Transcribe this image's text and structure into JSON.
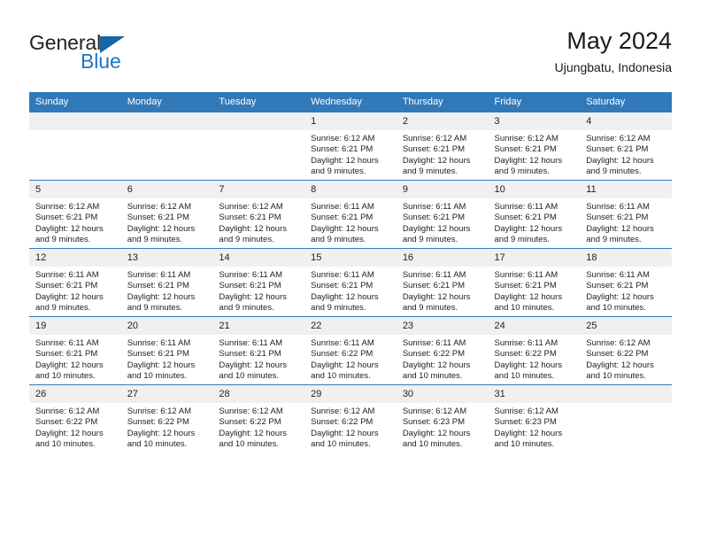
{
  "brand": {
    "name_part1": "General",
    "name_part2": "Blue",
    "triangle_color": "#1565a8",
    "blue_color": "#1b77c7"
  },
  "header": {
    "title": "May 2024",
    "subtitle": "Ujungbatu, Indonesia"
  },
  "theme": {
    "header_blue": "#3179b9",
    "daynum_band": "#f0f0f0",
    "text": "#222222"
  },
  "weekday_headers": [
    "Sunday",
    "Monday",
    "Tuesday",
    "Wednesday",
    "Thursday",
    "Friday",
    "Saturday"
  ],
  "labels": {
    "sunrise_prefix": "Sunrise:",
    "sunset_prefix": "Sunset:",
    "daylight_prefix": "Daylight:"
  },
  "weeks": [
    [
      {
        "day": "",
        "empty": true
      },
      {
        "day": "",
        "empty": true
      },
      {
        "day": "",
        "empty": true
      },
      {
        "day": "1",
        "sunrise": "Sunrise: 6:12 AM",
        "sunset": "Sunset: 6:21 PM",
        "daylight_line1": "Daylight: 12 hours",
        "daylight_line2": "and 9 minutes."
      },
      {
        "day": "2",
        "sunrise": "Sunrise: 6:12 AM",
        "sunset": "Sunset: 6:21 PM",
        "daylight_line1": "Daylight: 12 hours",
        "daylight_line2": "and 9 minutes."
      },
      {
        "day": "3",
        "sunrise": "Sunrise: 6:12 AM",
        "sunset": "Sunset: 6:21 PM",
        "daylight_line1": "Daylight: 12 hours",
        "daylight_line2": "and 9 minutes."
      },
      {
        "day": "4",
        "sunrise": "Sunrise: 6:12 AM",
        "sunset": "Sunset: 6:21 PM",
        "daylight_line1": "Daylight: 12 hours",
        "daylight_line2": "and 9 minutes."
      }
    ],
    [
      {
        "day": "5",
        "sunrise": "Sunrise: 6:12 AM",
        "sunset": "Sunset: 6:21 PM",
        "daylight_line1": "Daylight: 12 hours",
        "daylight_line2": "and 9 minutes."
      },
      {
        "day": "6",
        "sunrise": "Sunrise: 6:12 AM",
        "sunset": "Sunset: 6:21 PM",
        "daylight_line1": "Daylight: 12 hours",
        "daylight_line2": "and 9 minutes."
      },
      {
        "day": "7",
        "sunrise": "Sunrise: 6:12 AM",
        "sunset": "Sunset: 6:21 PM",
        "daylight_line1": "Daylight: 12 hours",
        "daylight_line2": "and 9 minutes."
      },
      {
        "day": "8",
        "sunrise": "Sunrise: 6:11 AM",
        "sunset": "Sunset: 6:21 PM",
        "daylight_line1": "Daylight: 12 hours",
        "daylight_line2": "and 9 minutes."
      },
      {
        "day": "9",
        "sunrise": "Sunrise: 6:11 AM",
        "sunset": "Sunset: 6:21 PM",
        "daylight_line1": "Daylight: 12 hours",
        "daylight_line2": "and 9 minutes."
      },
      {
        "day": "10",
        "sunrise": "Sunrise: 6:11 AM",
        "sunset": "Sunset: 6:21 PM",
        "daylight_line1": "Daylight: 12 hours",
        "daylight_line2": "and 9 minutes."
      },
      {
        "day": "11",
        "sunrise": "Sunrise: 6:11 AM",
        "sunset": "Sunset: 6:21 PM",
        "daylight_line1": "Daylight: 12 hours",
        "daylight_line2": "and 9 minutes."
      }
    ],
    [
      {
        "day": "12",
        "sunrise": "Sunrise: 6:11 AM",
        "sunset": "Sunset: 6:21 PM",
        "daylight_line1": "Daylight: 12 hours",
        "daylight_line2": "and 9 minutes."
      },
      {
        "day": "13",
        "sunrise": "Sunrise: 6:11 AM",
        "sunset": "Sunset: 6:21 PM",
        "daylight_line1": "Daylight: 12 hours",
        "daylight_line2": "and 9 minutes."
      },
      {
        "day": "14",
        "sunrise": "Sunrise: 6:11 AM",
        "sunset": "Sunset: 6:21 PM",
        "daylight_line1": "Daylight: 12 hours",
        "daylight_line2": "and 9 minutes."
      },
      {
        "day": "15",
        "sunrise": "Sunrise: 6:11 AM",
        "sunset": "Sunset: 6:21 PM",
        "daylight_line1": "Daylight: 12 hours",
        "daylight_line2": "and 9 minutes."
      },
      {
        "day": "16",
        "sunrise": "Sunrise: 6:11 AM",
        "sunset": "Sunset: 6:21 PM",
        "daylight_line1": "Daylight: 12 hours",
        "daylight_line2": "and 9 minutes."
      },
      {
        "day": "17",
        "sunrise": "Sunrise: 6:11 AM",
        "sunset": "Sunset: 6:21 PM",
        "daylight_line1": "Daylight: 12 hours",
        "daylight_line2": "and 10 minutes."
      },
      {
        "day": "18",
        "sunrise": "Sunrise: 6:11 AM",
        "sunset": "Sunset: 6:21 PM",
        "daylight_line1": "Daylight: 12 hours",
        "daylight_line2": "and 10 minutes."
      }
    ],
    [
      {
        "day": "19",
        "sunrise": "Sunrise: 6:11 AM",
        "sunset": "Sunset: 6:21 PM",
        "daylight_line1": "Daylight: 12 hours",
        "daylight_line2": "and 10 minutes."
      },
      {
        "day": "20",
        "sunrise": "Sunrise: 6:11 AM",
        "sunset": "Sunset: 6:21 PM",
        "daylight_line1": "Daylight: 12 hours",
        "daylight_line2": "and 10 minutes."
      },
      {
        "day": "21",
        "sunrise": "Sunrise: 6:11 AM",
        "sunset": "Sunset: 6:21 PM",
        "daylight_line1": "Daylight: 12 hours",
        "daylight_line2": "and 10 minutes."
      },
      {
        "day": "22",
        "sunrise": "Sunrise: 6:11 AM",
        "sunset": "Sunset: 6:22 PM",
        "daylight_line1": "Daylight: 12 hours",
        "daylight_line2": "and 10 minutes."
      },
      {
        "day": "23",
        "sunrise": "Sunrise: 6:11 AM",
        "sunset": "Sunset: 6:22 PM",
        "daylight_line1": "Daylight: 12 hours",
        "daylight_line2": "and 10 minutes."
      },
      {
        "day": "24",
        "sunrise": "Sunrise: 6:11 AM",
        "sunset": "Sunset: 6:22 PM",
        "daylight_line1": "Daylight: 12 hours",
        "daylight_line2": "and 10 minutes."
      },
      {
        "day": "25",
        "sunrise": "Sunrise: 6:12 AM",
        "sunset": "Sunset: 6:22 PM",
        "daylight_line1": "Daylight: 12 hours",
        "daylight_line2": "and 10 minutes."
      }
    ],
    [
      {
        "day": "26",
        "sunrise": "Sunrise: 6:12 AM",
        "sunset": "Sunset: 6:22 PM",
        "daylight_line1": "Daylight: 12 hours",
        "daylight_line2": "and 10 minutes."
      },
      {
        "day": "27",
        "sunrise": "Sunrise: 6:12 AM",
        "sunset": "Sunset: 6:22 PM",
        "daylight_line1": "Daylight: 12 hours",
        "daylight_line2": "and 10 minutes."
      },
      {
        "day": "28",
        "sunrise": "Sunrise: 6:12 AM",
        "sunset": "Sunset: 6:22 PM",
        "daylight_line1": "Daylight: 12 hours",
        "daylight_line2": "and 10 minutes."
      },
      {
        "day": "29",
        "sunrise": "Sunrise: 6:12 AM",
        "sunset": "Sunset: 6:22 PM",
        "daylight_line1": "Daylight: 12 hours",
        "daylight_line2": "and 10 minutes."
      },
      {
        "day": "30",
        "sunrise": "Sunrise: 6:12 AM",
        "sunset": "Sunset: 6:23 PM",
        "daylight_line1": "Daylight: 12 hours",
        "daylight_line2": "and 10 minutes."
      },
      {
        "day": "31",
        "sunrise": "Sunrise: 6:12 AM",
        "sunset": "Sunset: 6:23 PM",
        "daylight_line1": "Daylight: 12 hours",
        "daylight_line2": "and 10 minutes."
      },
      {
        "day": "",
        "empty": true
      }
    ]
  ]
}
